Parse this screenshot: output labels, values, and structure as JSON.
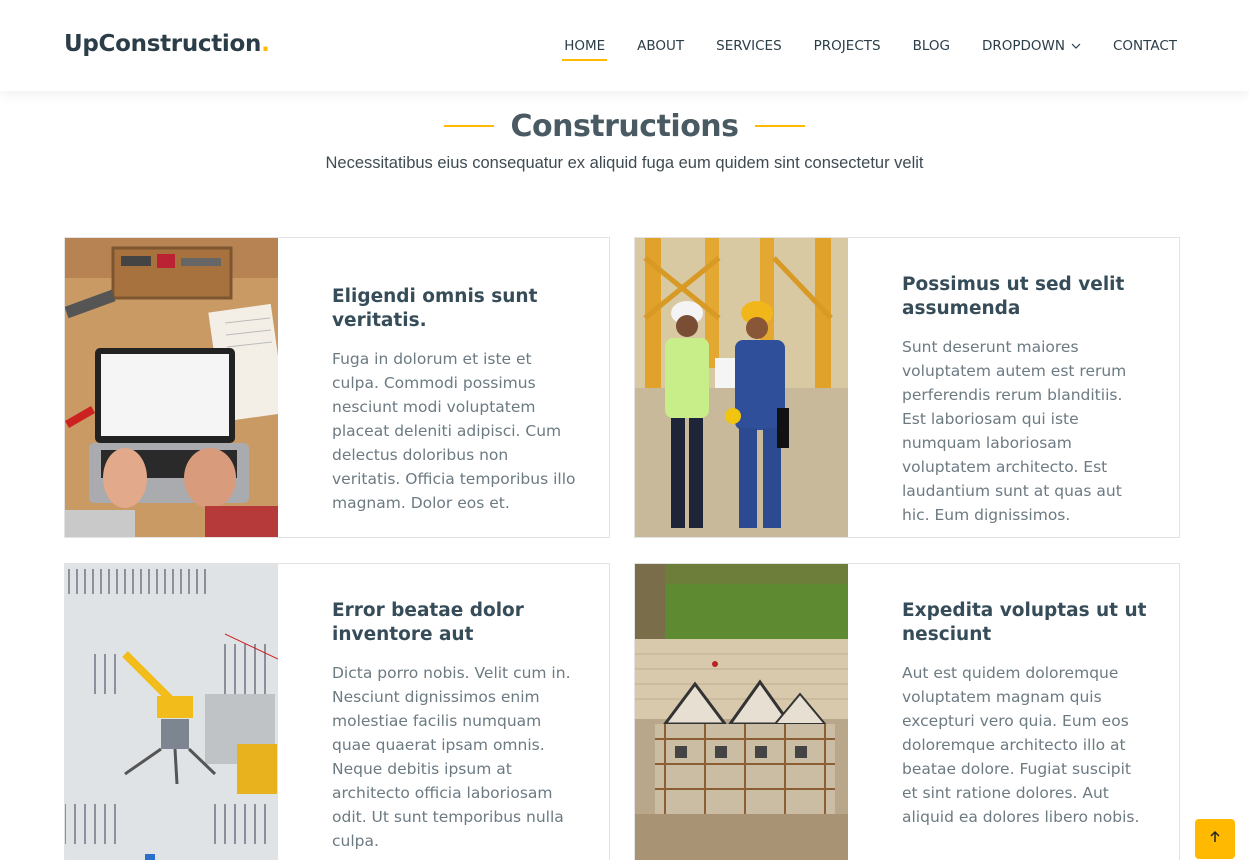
{
  "brand": {
    "name": "UpConstruction",
    "dot": "."
  },
  "nav": {
    "items": [
      {
        "label": "HOME",
        "active": true
      },
      {
        "label": "ABOUT"
      },
      {
        "label": "SERVICES"
      },
      {
        "label": "PROJECTS"
      },
      {
        "label": "BLOG"
      },
      {
        "label": "DROPDOWN",
        "icon": "chevron-down-icon"
      },
      {
        "label": "CONTACT"
      }
    ]
  },
  "section": {
    "title": "Constructions",
    "subtitle": "Necessitatibus eius consequatur ex aliquid fuga eum quidem sint consectetur velit"
  },
  "cards": [
    {
      "title": "Eligendi omnis sunt veritatis.",
      "text": "Fuga in dolorum et iste et culpa. Commodi possimus nesciunt modi voluptatem placeat deleniti adipisci. Cum delectus doloribus non veritatis. Officia temporibus illo magnam. Dolor eos et.",
      "image": "laptop-on-workbench"
    },
    {
      "title": "Possimus ut sed velit assumenda",
      "text": "Sunt deserunt maiores voluptatem autem est rerum perferendis rerum blanditiis. Est laboriosam qui iste numquam laboriosam voluptatem architecto. Est laudantium sunt at quas aut hic. Eum dignissimos.",
      "image": "engineers-on-site"
    },
    {
      "title": "Error beatae dolor inventore aut",
      "text": "Dicta porro nobis. Velit cum in. Nesciunt dignissimos enim molestiae facilis numquam quae quaerat ipsam omnis. Neque debitis ipsum at architecto officia laboriosam odit. Ut sunt temporibus nulla culpa.",
      "image": "rebar-site-aerial"
    },
    {
      "title": "Expedita voluptas ut ut nesciunt",
      "text": "Aut est quidem doloremque voluptatem magnam quis excepturi vero quia. Eum eos doloremque architecto illo at beatae dolore. Fugiat suscipit et sint ratione dolores. Aut aliquid ea dolores libero nobis.",
      "image": "houses-under-construction"
    }
  ],
  "colors": {
    "accent": "#feb900",
    "heading": "#364d59",
    "text": "#6c7a82"
  },
  "scroll_top": {
    "icon": "arrow-up-icon"
  }
}
